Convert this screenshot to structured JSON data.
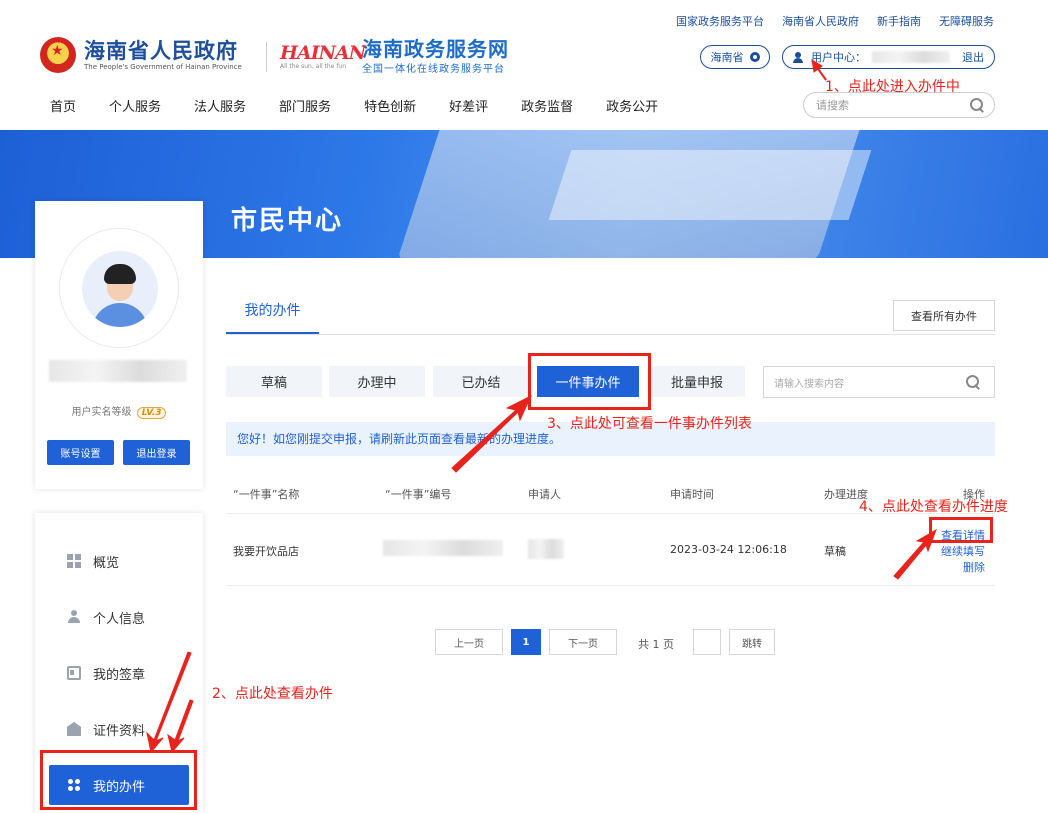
{
  "header": {
    "top_links": [
      "国家政务服务平台",
      "海南省人民政府",
      "新手指南",
      "无障碍服务"
    ],
    "gov_title": "海南省人民政府",
    "gov_subtitle": "The People's Government of Hainan Province",
    "hainan_word": "HAINAN",
    "hainan_slogan": "All the sun, all the fun",
    "portal_title": "海南政务服务网",
    "portal_subtitle": "全国一体化在线政务服务平台",
    "region": "海南省",
    "user_center_label": "用户中心：",
    "logout": "退出",
    "nav": [
      "首页",
      "个人服务",
      "法人服务",
      "部门服务",
      "特色创新",
      "好差评",
      "政务监督",
      "政务公开"
    ],
    "search_placeholder": "请搜索"
  },
  "banner": {
    "title": "市民中心"
  },
  "profile": {
    "level_label": "用户实名等级",
    "level_badge": "LV.3",
    "account_settings": "账号设置",
    "logout_button": "退出登录"
  },
  "menu": {
    "items": [
      {
        "label": "概览",
        "icon": "grid-icon"
      },
      {
        "label": "个人信息",
        "icon": "person-icon"
      },
      {
        "label": "我的签章",
        "icon": "id-card-icon"
      },
      {
        "label": "证件资料",
        "icon": "envelope-icon"
      },
      {
        "label": "我的办件",
        "icon": "flower-icon",
        "active": true
      }
    ]
  },
  "main": {
    "tab": "我的办件",
    "view_all": "查看所有办件",
    "status_tabs": [
      "草稿",
      "办理中",
      "已办结",
      "一件事办件",
      "批量申报"
    ],
    "active_status_tab": "一件事办件",
    "search_placeholder": "请输入搜索内容",
    "notice": "您好！如您刚提交申报，请刷新此页面查看最新的办理进度。",
    "table": {
      "headers": [
        "“一件事”名称",
        "“一件事”编号",
        "申请人",
        "申请时间",
        "办理进度",
        "操作"
      ],
      "rows": [
        {
          "name": "我要开饮品店",
          "time": "2023-03-24 12:06:18",
          "status": "草稿",
          "actions": [
            "查看详情",
            "继续填写",
            "删除"
          ]
        }
      ]
    },
    "pagination": {
      "prev": "上一页",
      "current": "1",
      "next": "下一页",
      "total": "共 1 页",
      "go": "跳转"
    }
  },
  "annotations": [
    "1、点此处进入办件中",
    "2、点此处查看办件",
    "3、点此处可查看一件事办件列表",
    "4、点此处查看办件进度"
  ],
  "colors": {
    "primary": "#1f61d6",
    "annotation": "#e8231c",
    "nav_text": "#1a4e9c"
  }
}
